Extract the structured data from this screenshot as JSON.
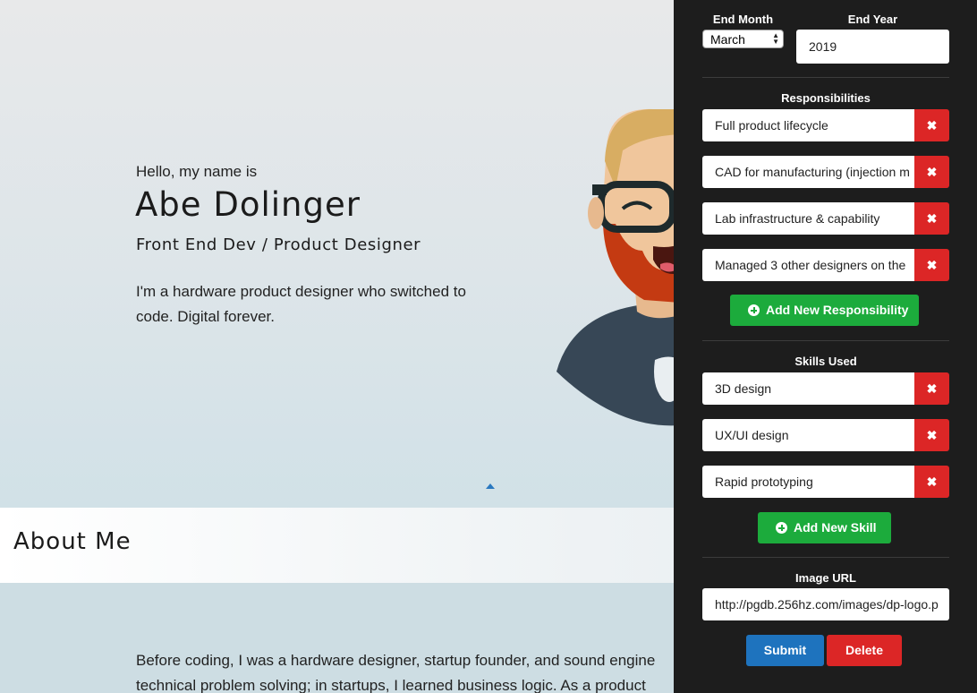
{
  "hero": {
    "greeting": "Hello, my name is",
    "name": "Abe Dolinger",
    "role": "Front End Dev / Product Designer",
    "blurb": "I'm a hardware product designer who switched to code. Digital forever."
  },
  "about": {
    "title": "About Me",
    "text_line1": "Before coding, I was a hardware designer, startup founder, and sound engine",
    "text_line2": "technical problem solving; in startups, I learned business logic. As a product"
  },
  "panel": {
    "end_month_label": "End Month",
    "end_month_value": "March",
    "end_year_label": "End Year",
    "end_year_value": "2019",
    "responsibilities_label": "Responsibilities",
    "responsibilities": [
      "Full product lifecycle",
      "CAD for manufacturing (injection m",
      "Lab infrastructure & capability",
      "Managed 3 other designers on the"
    ],
    "add_responsibility_label": "Add New Responsibility",
    "skills_label": "Skills Used",
    "skills": [
      "3D design",
      "UX/UI design",
      "Rapid prototyping"
    ],
    "add_skill_label": "Add New Skill",
    "image_url_label": "Image URL",
    "image_url_value": "http://pgdb.256hz.com/images/dp-logo.p",
    "submit_label": "Submit",
    "delete_label": "Delete"
  },
  "colors": {
    "panel_bg": "#1d1d1d",
    "add_green": "#1cab3c",
    "delete_red": "#dc2626",
    "submit_blue": "#1e73be"
  }
}
